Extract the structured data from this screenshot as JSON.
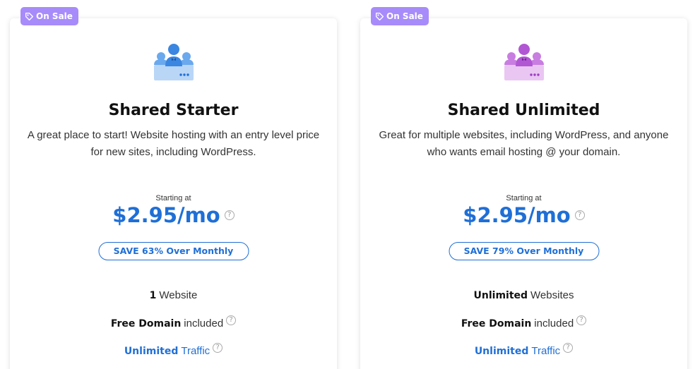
{
  "colors": {
    "accent": "#1f6fd6",
    "badge": "#a78bfa",
    "starter_illus": "#6aa9ee",
    "unlimited_illus": "#c87ee0"
  },
  "plans": [
    {
      "badge": "On Sale",
      "icon": "users-server-icon",
      "title": "Shared Starter",
      "description": "A great place to start! Website hosting with an entry level price for new sites, including WordPress.",
      "starting_at": "Starting at",
      "price": "$2.95/mo",
      "save": "SAVE 63% Over Monthly",
      "features": [
        {
          "bold": "1",
          "text": "Website"
        },
        {
          "bold": "Free Domain",
          "text": "included"
        },
        {
          "bold": "Unlimited",
          "text": "Traffic"
        }
      ]
    },
    {
      "badge": "On Sale",
      "icon": "users-server-icon",
      "title": "Shared Unlimited",
      "description": "Great for multiple websites, including WordPress, and anyone who wants email hosting @ your domain.",
      "starting_at": "Starting at",
      "price": "$2.95/mo",
      "save": "SAVE 79% Over Monthly",
      "features": [
        {
          "bold": "Unlimited",
          "text": "Websites"
        },
        {
          "bold": "Free Domain",
          "text": "included"
        },
        {
          "bold": "Unlimited",
          "text": "Traffic"
        }
      ]
    }
  ]
}
